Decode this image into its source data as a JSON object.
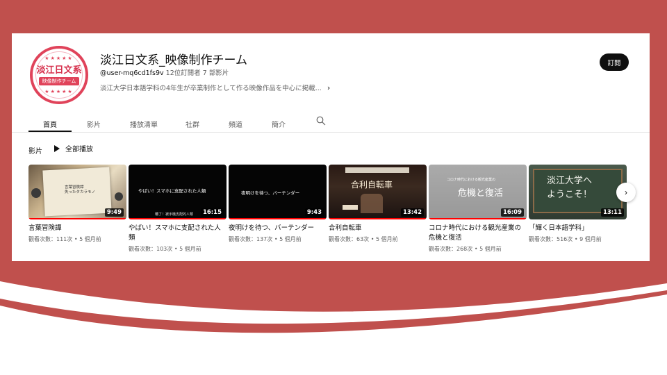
{
  "channel": {
    "logo_title": "淡江日文系",
    "logo_sub": "映像制作チーム",
    "name": "淡江日文系_映像制作チーム",
    "handle": "@user-mq6cd1fs9v",
    "subscribers": "12位訂閱者",
    "video_count": "7 部影片",
    "description": "淡江大学日本語学科の4年生が卒業制作として作る映像作品を中心に掲載...",
    "subscribe_label": "訂閱"
  },
  "tabs": [
    {
      "label": "首頁",
      "active": true
    },
    {
      "label": "影片",
      "active": false
    },
    {
      "label": "播放清單",
      "active": false
    },
    {
      "label": "社群",
      "active": false
    },
    {
      "label": "頻道",
      "active": false
    },
    {
      "label": "簡介",
      "active": false
    }
  ],
  "section": {
    "title": "影片",
    "play_all_label": "全部播放"
  },
  "videos": [
    {
      "title": "言葉冒険譚",
      "views": "觀看次數：111次",
      "age": "5 個月前",
      "duration": "9:49",
      "thumb_text": "言葉冒険譚\n失ったタカラモノ",
      "progress": 1.0
    },
    {
      "title": "やばい！スマホに支配された人類",
      "views": "觀看次數：103次",
      "age": "5 個月前",
      "duration": "16:15",
      "thumb_text": "やばい！スマホに支配された人類",
      "thumb_sub": "糟了！被手機支配的人類",
      "progress": 1.0
    },
    {
      "title": "夜明けを待つ、バーテンダー",
      "views": "觀看次數：137次",
      "age": "5 個月前",
      "duration": "9:43",
      "thumb_text": "夜明けを待つ、バーテンダー",
      "progress": 1.0
    },
    {
      "title": "合利自転車",
      "views": "觀看次數：63次",
      "age": "5 個月前",
      "duration": "13:42",
      "thumb_text": "合利自転車",
      "progress": 1.0
    },
    {
      "title": "コロナ時代における観光産業の危機と復活",
      "views": "觀看次數：268次",
      "age": "5 個月前",
      "duration": "16:09",
      "thumb_text": "危機と復活",
      "thumb_sub": "コロナ時代における観光産業の",
      "progress": 1.0
    },
    {
      "title": "「輝く日本語学科」",
      "views": "觀看次數：516次",
      "age": "9 個月前",
      "duration": "13:11",
      "thumb_text": "淡江大学へ\nようこそ！",
      "progress": 0.0
    }
  ],
  "colors": {
    "slide_red": "#c0504d",
    "progress_red": "#ff0000"
  }
}
